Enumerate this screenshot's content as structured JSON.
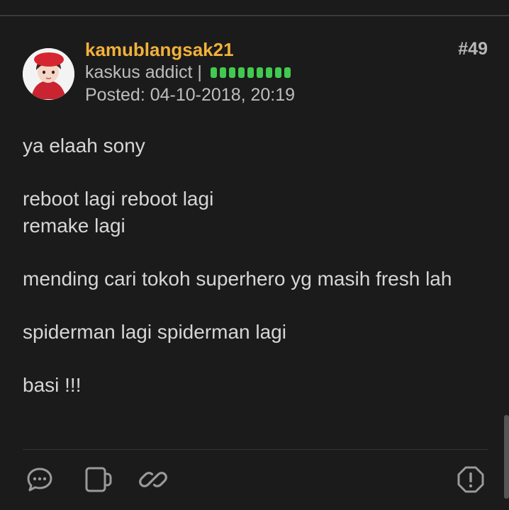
{
  "post": {
    "username": "kamublangsak21",
    "post_number": "#49",
    "rank": "kaskus addict |",
    "reputation_level": 9,
    "posted": "Posted: 04-10-2018, 20:19",
    "paragraphs": [
      "ya elaah sony",
      "reboot lagi reboot lagi\nremake lagi",
      "mending cari tokoh superhero yg masih fresh lah",
      "spiderman lagi spiderman lagi",
      "basi !!!"
    ]
  },
  "colors": {
    "background": "#1b1b1b",
    "username": "#f2b13a",
    "reputation": "#42c94f",
    "text": "#d6d6d6",
    "icon": "#9a9a9a"
  },
  "icons": [
    "comment-icon",
    "quote-icon",
    "link-icon",
    "report-icon"
  ]
}
